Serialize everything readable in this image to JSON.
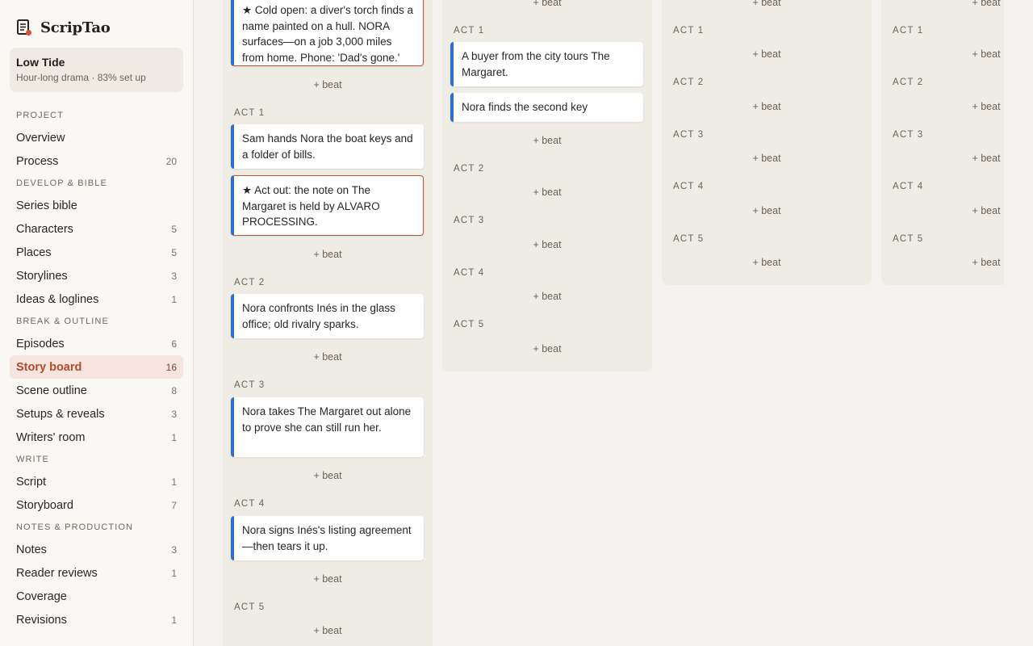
{
  "app": {
    "name": "ScripTao"
  },
  "project": {
    "title": "Low Tide",
    "subtitle": "Hour-long drama · 83% set up"
  },
  "nav": {
    "sections": [
      {
        "title": "PROJECT",
        "items": [
          {
            "label": "Overview",
            "count": ""
          },
          {
            "label": "Process",
            "count": "20"
          }
        ]
      },
      {
        "title": "DEVELOP & BIBLE",
        "items": [
          {
            "label": "Series bible",
            "count": ""
          },
          {
            "label": "Characters",
            "count": "5"
          },
          {
            "label": "Places",
            "count": "5"
          },
          {
            "label": "Storylines",
            "count": "3"
          },
          {
            "label": "Ideas & loglines",
            "count": "1"
          }
        ]
      },
      {
        "title": "BREAK & OUTLINE",
        "items": [
          {
            "label": "Episodes",
            "count": "6"
          },
          {
            "label": "Story board",
            "count": "16",
            "active": true
          },
          {
            "label": "Scene outline",
            "count": "8"
          },
          {
            "label": "Setups & reveals",
            "count": "3"
          },
          {
            "label": "Writers' room",
            "count": "1"
          }
        ]
      },
      {
        "title": "WRITE",
        "items": [
          {
            "label": "Script",
            "count": "1"
          },
          {
            "label": "Storyboard",
            "count": "7"
          }
        ]
      },
      {
        "title": "NOTES & PRODUCTION",
        "items": [
          {
            "label": "Notes",
            "count": "3"
          },
          {
            "label": "Reader reviews",
            "count": "1"
          },
          {
            "label": "Coverage",
            "count": ""
          },
          {
            "label": "Revisions",
            "count": "1"
          }
        ]
      }
    ]
  },
  "board": {
    "add_beat": "+ beat",
    "acts": [
      "ACT 1",
      "ACT 2",
      "ACT 3",
      "ACT 4",
      "ACT 5"
    ],
    "columns": [
      {
        "cold_open": "★ Cold open: a diver's torch finds a name painted on a hull. NORA surfaces—on a job 3,000 miles from home. Phone: 'Dad's gone.'",
        "act1": [
          "Sam hands Nora the boat keys and a folder of bills.",
          "★ Act out: the note on The Margaret is held by ALVARO PROCESSING."
        ],
        "act2": [
          "Nora confronts Inés in the glass office; old rivalry sparks."
        ],
        "act3": [
          "Nora takes The Margaret out alone to prove she can still run her."
        ],
        "act4": [
          "Nora signs Inés's listing agreement—then tears it up."
        ]
      },
      {
        "act1": [
          "A buyer from the city tours The Margaret.",
          "Nora finds the second key"
        ]
      }
    ]
  }
}
